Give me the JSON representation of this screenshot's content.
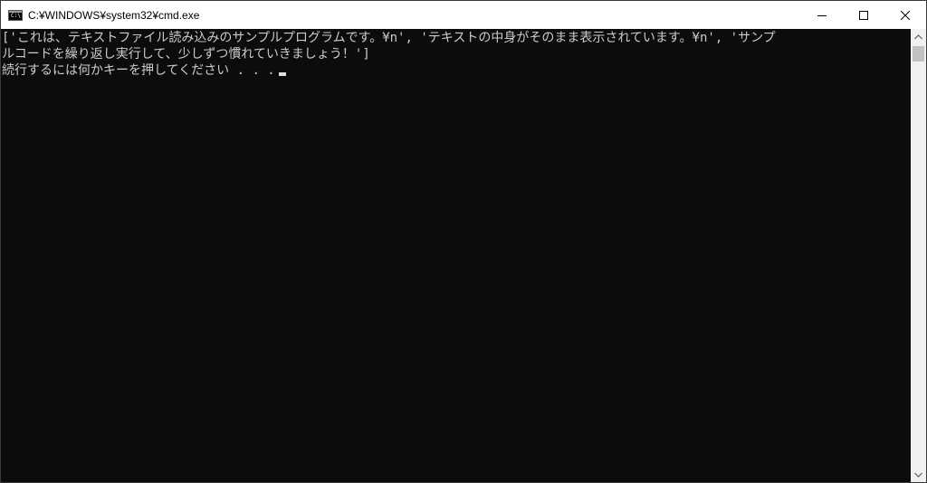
{
  "window": {
    "title": "C:¥WINDOWS¥system32¥cmd.exe",
    "icon": "cmd-app-icon",
    "icon_glyph": "C:\\"
  },
  "caption_buttons": [
    {
      "name": "minimize",
      "icon": "minimize-icon"
    },
    {
      "name": "maximize",
      "icon": "maximize-icon"
    },
    {
      "name": "close",
      "icon": "close-icon"
    }
  ],
  "console": {
    "lines": [
      "['これは、テキストファイル読み込みのサンプルプログラムです。¥n', 'テキストの中身がそのまま表示されています。¥n', 'サンプ",
      "ルコードを繰り返し実行して、少しずつ慣れていきましょう！']",
      "続行するには何かキーを押してください . . ."
    ],
    "background": "#0c0c0c",
    "foreground": "#cccccc"
  },
  "scrollbar": {
    "up_icon": "scroll-up-arrow-icon",
    "down_icon": "scroll-down-arrow-icon"
  }
}
